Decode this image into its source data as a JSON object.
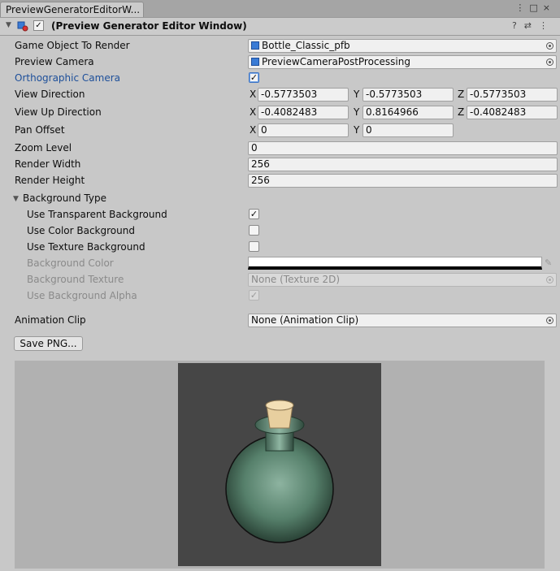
{
  "tab": {
    "title": "PreviewGeneratorEditorW..."
  },
  "tab_icons": {
    "menu": "⋮",
    "maximize": "□",
    "close": "×"
  },
  "header": {
    "title": "(Preview Generator Editor Window)",
    "enabled_check": "✓",
    "tools": {
      "help": "?",
      "settings": "⇄",
      "more": "⋮"
    }
  },
  "fields": {
    "game_object": {
      "label": "Game Object To Render",
      "value": "Bottle_Classic_pfb"
    },
    "camera": {
      "label": "Preview Camera",
      "value": "PreviewCameraPostProcessing"
    },
    "orthographic": {
      "label": "Orthographic Camera",
      "checked": "✓"
    },
    "view_direction": {
      "label": "View Direction",
      "x": "-0.5773503",
      "y": "-0.5773503",
      "z": "-0.5773503"
    },
    "view_up": {
      "label": "View Up Direction",
      "x": "-0.4082483",
      "y": "0.8164966",
      "z": "-0.4082483"
    },
    "pan_offset": {
      "label": "Pan Offset",
      "x": "0",
      "y": "0"
    },
    "zoom": {
      "label": "Zoom Level",
      "value": "0"
    },
    "render_width": {
      "label": "Render Width",
      "value": "256"
    },
    "render_height": {
      "label": "Render Height",
      "value": "256"
    }
  },
  "axes": {
    "x": "X",
    "y": "Y",
    "z": "Z"
  },
  "background": {
    "foldout_label": "Background Type",
    "transparent": {
      "label": "Use Transparent Background",
      "checked": "✓"
    },
    "color": {
      "label": "Use Color Background",
      "checked": ""
    },
    "texture": {
      "label": "Use Texture Background",
      "checked": ""
    },
    "bg_color": {
      "label": "Background Color",
      "value": "#ffffff"
    },
    "bg_texture": {
      "label": "Background Texture",
      "value": "None (Texture 2D)"
    },
    "bg_alpha": {
      "label": "Use Background Alpha",
      "checked": "✓"
    }
  },
  "animation": {
    "label": "Animation Clip",
    "value": "None (Animation Clip)"
  },
  "save_button": {
    "label": "Save PNG..."
  },
  "colors": {
    "accent": "#1d4f9a",
    "preview_bg": "#464646",
    "bottle": "#4f7d66"
  }
}
